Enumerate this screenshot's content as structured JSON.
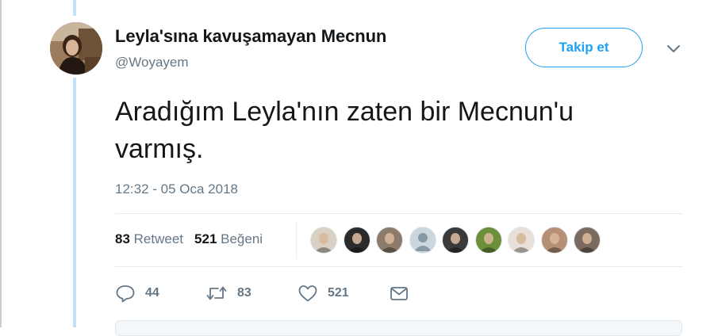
{
  "tweet": {
    "author": {
      "display_name": "Leyla'sına kavuşamayan Mecnun",
      "handle": "@Woyayem",
      "avatar_icon": "profile-photo"
    },
    "follow_button_label": "Takip et",
    "text": "Aradığım Leyla'nın zaten bir Mecnun'u\nvarmış.",
    "timestamp": "12:32 - 05 Oca 2018",
    "stats": {
      "retweets_count": "83",
      "retweets_label": "Retweet",
      "likes_count": "521",
      "likes_label": "Beğeni"
    },
    "likers": [
      {
        "icon": "liker-avatar",
        "bg": "#d9cfc3"
      },
      {
        "icon": "liker-avatar",
        "bg": "#2b2b2b"
      },
      {
        "icon": "liker-avatar",
        "bg": "#8c7b6a"
      },
      {
        "icon": "default-avatar",
        "bg": "#ccd6dd"
      },
      {
        "icon": "liker-avatar",
        "bg": "#3a3a3a"
      },
      {
        "icon": "liker-avatar",
        "bg": "#6b8f3a"
      },
      {
        "icon": "liker-avatar",
        "bg": "#e8e0d8"
      },
      {
        "icon": "liker-avatar",
        "bg": "#b78f74"
      },
      {
        "icon": "liker-avatar",
        "bg": "#7a6a60"
      }
    ],
    "actions": {
      "reply_count": "44",
      "retweet_count": "83",
      "like_count": "521"
    }
  },
  "colors": {
    "accent": "#1da1f2",
    "thread_line": "#c4e2f6",
    "muted_text": "#657786"
  }
}
